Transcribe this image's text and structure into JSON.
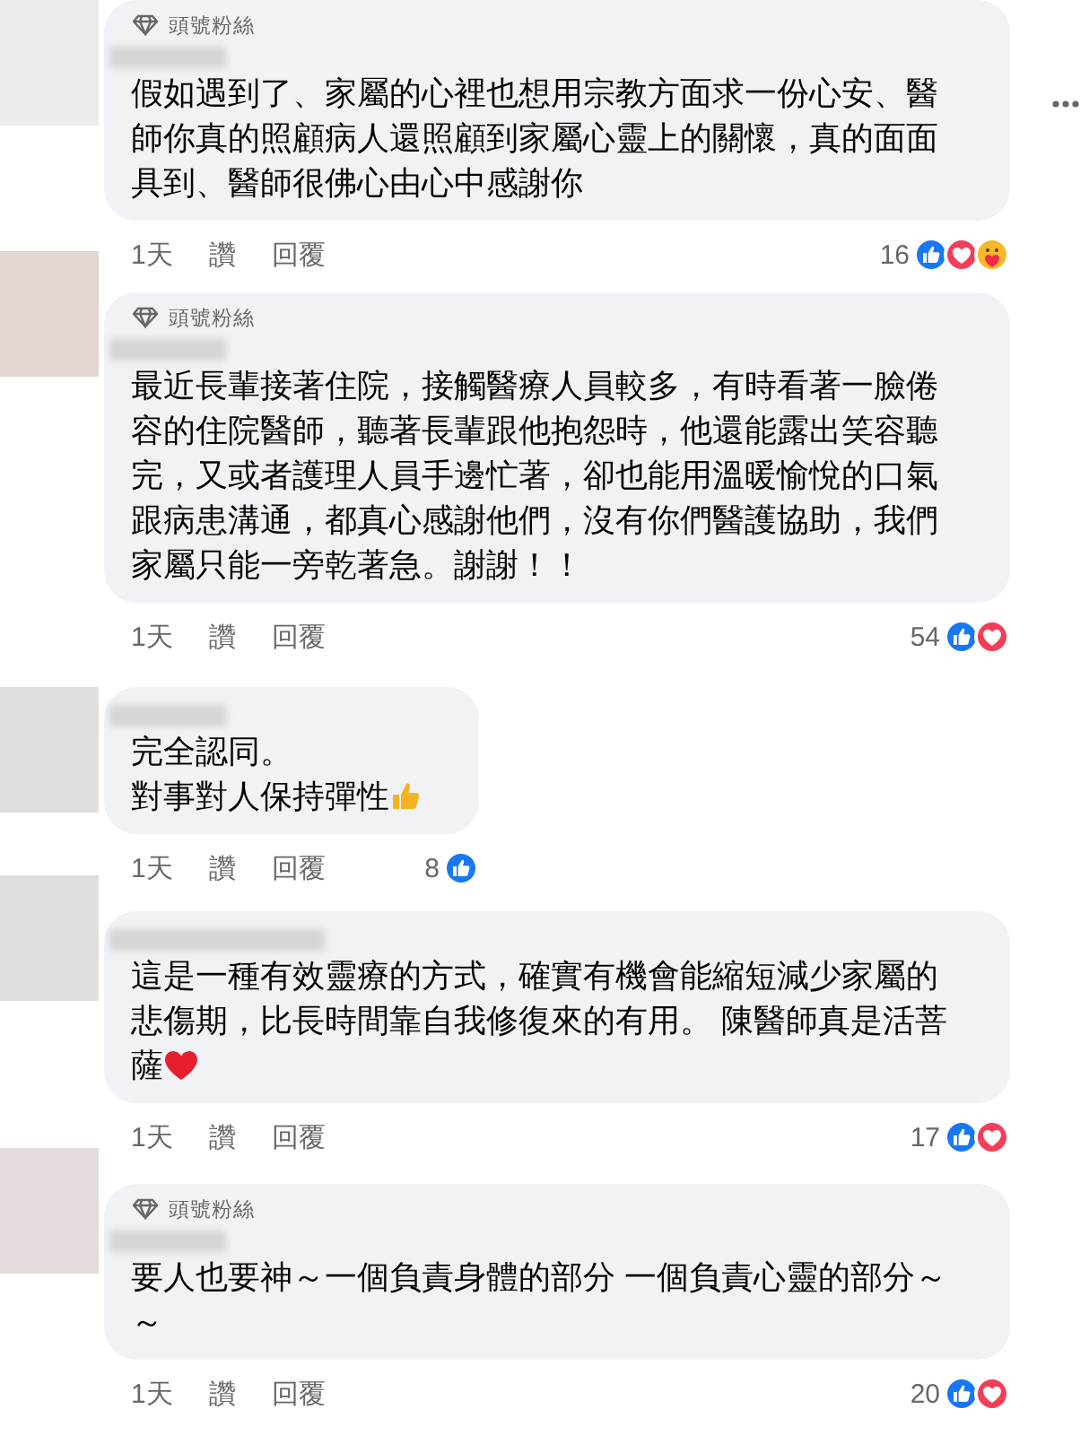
{
  "comments": [
    {
      "badge": "頭號粉絲",
      "text": "假如遇到了、家屬的心裡也想用宗教方面求一份心安、醫師你真的照顧病人還照顧到家屬心靈上的關懷，真的面面具到、醫師很佛心由心中感謝你",
      "time": "1天",
      "like": "讚",
      "reply": "回覆",
      "reaction_count": "16",
      "reactions": [
        {
          "kind": "like"
        },
        {
          "kind": "love"
        },
        {
          "kind": "care"
        }
      ],
      "menu": true
    },
    {
      "badge": "頭號粉絲",
      "text": "最近長輩接著住院，接觸醫療人員較多，有時看著一臉倦容的住院醫師，聽著長輩跟他抱怨時，他還能露出笑容聽完，又或者護理人員手邊忙著，卻也能用溫暖愉悅的口氣跟病患溝通，都真心感謝他們，沒有你們醫護協助，我們家屬只能一旁乾著急。謝謝！！",
      "time": "1天",
      "like": "讚",
      "reply": "回覆",
      "reaction_count": "54",
      "reactions": [
        {
          "kind": "like"
        },
        {
          "kind": "love"
        }
      ],
      "menu": false
    },
    {
      "lines": [
        "完全認同。",
        "對事對人保持彈性"
      ],
      "emoji": {
        "kind": "thumb"
      },
      "time": "1天",
      "like": "讚",
      "reply": "回覆",
      "reaction_count": "8",
      "reactions": [
        {
          "kind": "like"
        }
      ],
      "menu": false
    },
    {
      "text": "這是一種有效靈療的方式，確實有機會能縮短減少家屬的悲傷期，比長時間靠自我修復來的有用。 陳醫師真是活菩薩",
      "emoji": {
        "kind": "heart"
      },
      "time": "1天",
      "like": "讚",
      "reply": "回覆",
      "reaction_count": "17",
      "reactions": [
        {
          "kind": "like"
        },
        {
          "kind": "love"
        }
      ],
      "menu": false
    },
    {
      "badge": "頭號粉絲",
      "text": "要人也要神～一個負責身體的部分 一個負責心靈的部分～～",
      "time": "1天",
      "like": "讚",
      "reply": "回覆",
      "reaction_count": "20",
      "reactions": [
        {
          "kind": "like"
        },
        {
          "kind": "love"
        }
      ],
      "menu": false
    }
  ]
}
